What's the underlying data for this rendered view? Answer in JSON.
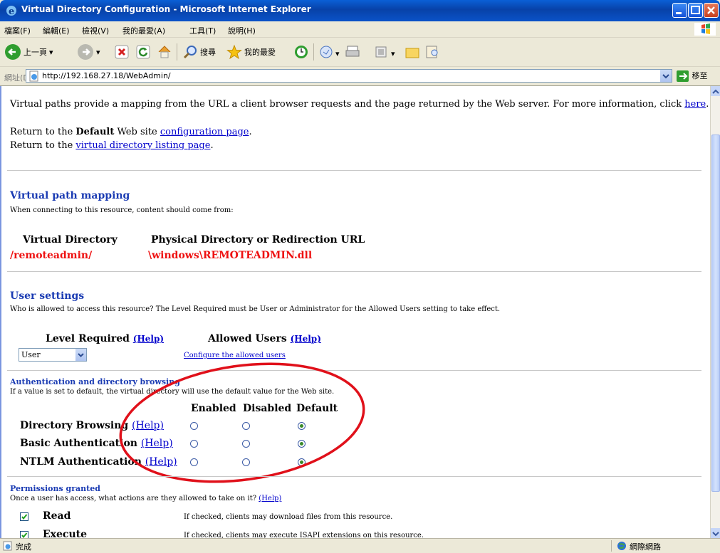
{
  "window": {
    "title": "Virtual Directory Configuration - Microsoft Internet Explorer"
  },
  "menu": [
    "檔案(F)",
    "編輯(E)",
    "檢視(V)",
    "我的最愛(A)",
    "工具(T)",
    "說明(H)"
  ],
  "toolbar": {
    "back": "上一頁",
    "search": "搜尋",
    "favorites": "我的最愛"
  },
  "address": {
    "label": "網址(D)",
    "url": "http://192.168.27.18/WebAdmin/",
    "go": "移至"
  },
  "intro": {
    "text": "Virtual paths provide a mapping from the URL a client browser requests and the page returned by the Web server. For more information, click ",
    "link": "here",
    "end": "."
  },
  "return1": {
    "pre": "Return to the ",
    "bold": "Default",
    "mid": " Web site ",
    "link": "configuration page",
    "end": "."
  },
  "return2": {
    "pre": "Return to the ",
    "link": "virtual directory listing page",
    "end": "."
  },
  "mapping": {
    "heading": "Virtual path mapping",
    "desc": "When connecting to this resource, content should come from:",
    "col1": "Virtual Directory",
    "col2": "Physical Directory or Redirection URL",
    "virtual": "/remoteadmin/",
    "physical": "\\windows\\REMOTEADMIN.dll"
  },
  "user_settings": {
    "heading": "User settings",
    "desc": "Who is allowed to access this resource? The Level Required must be User or Administrator for the Allowed Users setting to take effect.",
    "level_label": "Level Required",
    "allowed_label": "Allowed Users",
    "help": "(Help)",
    "level_value": "User",
    "configure_link": "Configure the allowed users"
  },
  "auth": {
    "heading": "Authentication and directory browsing",
    "desc": "If a value is set to default, the virtual directory will use the default value for the Web site.",
    "columns": [
      "Enabled",
      "Disabled",
      "Default"
    ],
    "help": "(Help)",
    "rows": [
      {
        "label": "Directory Browsing",
        "selected": "Default"
      },
      {
        "label": "Basic Authentication",
        "selected": "Default"
      },
      {
        "label": "NTLM Authentication",
        "selected": "Default"
      }
    ]
  },
  "permissions": {
    "heading": "Permissions granted",
    "desc": "Once a user has access, what actions are they allowed to take on it?",
    "help": "(Help)",
    "items": [
      {
        "label": "Read",
        "checked": true,
        "desc": "If checked, clients may download files from this resource."
      },
      {
        "label": "Execute",
        "checked": true,
        "desc": "If checked, clients may execute ISAPI extensions on this resource."
      }
    ]
  },
  "status": {
    "left": "完成",
    "zone": "網際網路"
  },
  "colors": {
    "annotation": "#e0101a",
    "link": "#0000cc",
    "heading": "#1a3bb3"
  }
}
